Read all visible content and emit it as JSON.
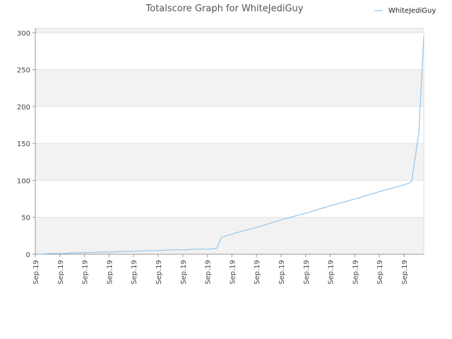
{
  "chart_data": {
    "type": "line",
    "title": "Totalscore Graph for WhiteJediGuy",
    "xlabel": "",
    "ylabel": "",
    "ylim": [
      0,
      306
    ],
    "y_ticks": [
      0,
      50,
      100,
      150,
      200,
      250,
      300
    ],
    "x_tick_labels": [
      "Sep.19",
      "Sep.19",
      "Sep.19",
      "Sep.19",
      "Sep.19",
      "Sep.19",
      "Sep.19",
      "Sep.19",
      "Sep.19",
      "Sep.19",
      "Sep.19",
      "Sep.19",
      "Sep.19",
      "Sep.19",
      "Sep.19",
      "Sep.19"
    ],
    "legend": {
      "position": "top-right"
    },
    "grid": true,
    "band_colors": [
      "#f2f2f2",
      "#ffffff"
    ],
    "series": [
      {
        "name": "WhiteJediGuy",
        "color": "#92c5eb",
        "x": [
          0,
          0.5,
          1,
          1.5,
          2,
          2.5,
          3,
          3.5,
          4,
          4.5,
          5,
          5.5,
          6,
          6.5,
          7,
          7.3,
          7.5,
          8,
          9,
          10,
          11,
          12,
          13,
          14,
          15,
          15.3,
          15.6,
          15.8
        ],
        "values": [
          0,
          1,
          1,
          2,
          2,
          3,
          3,
          4,
          4,
          5,
          5,
          6,
          6,
          7,
          7,
          8,
          23,
          28,
          37,
          47,
          56,
          66,
          75,
          85,
          94,
          98,
          165,
          295
        ]
      }
    ]
  }
}
